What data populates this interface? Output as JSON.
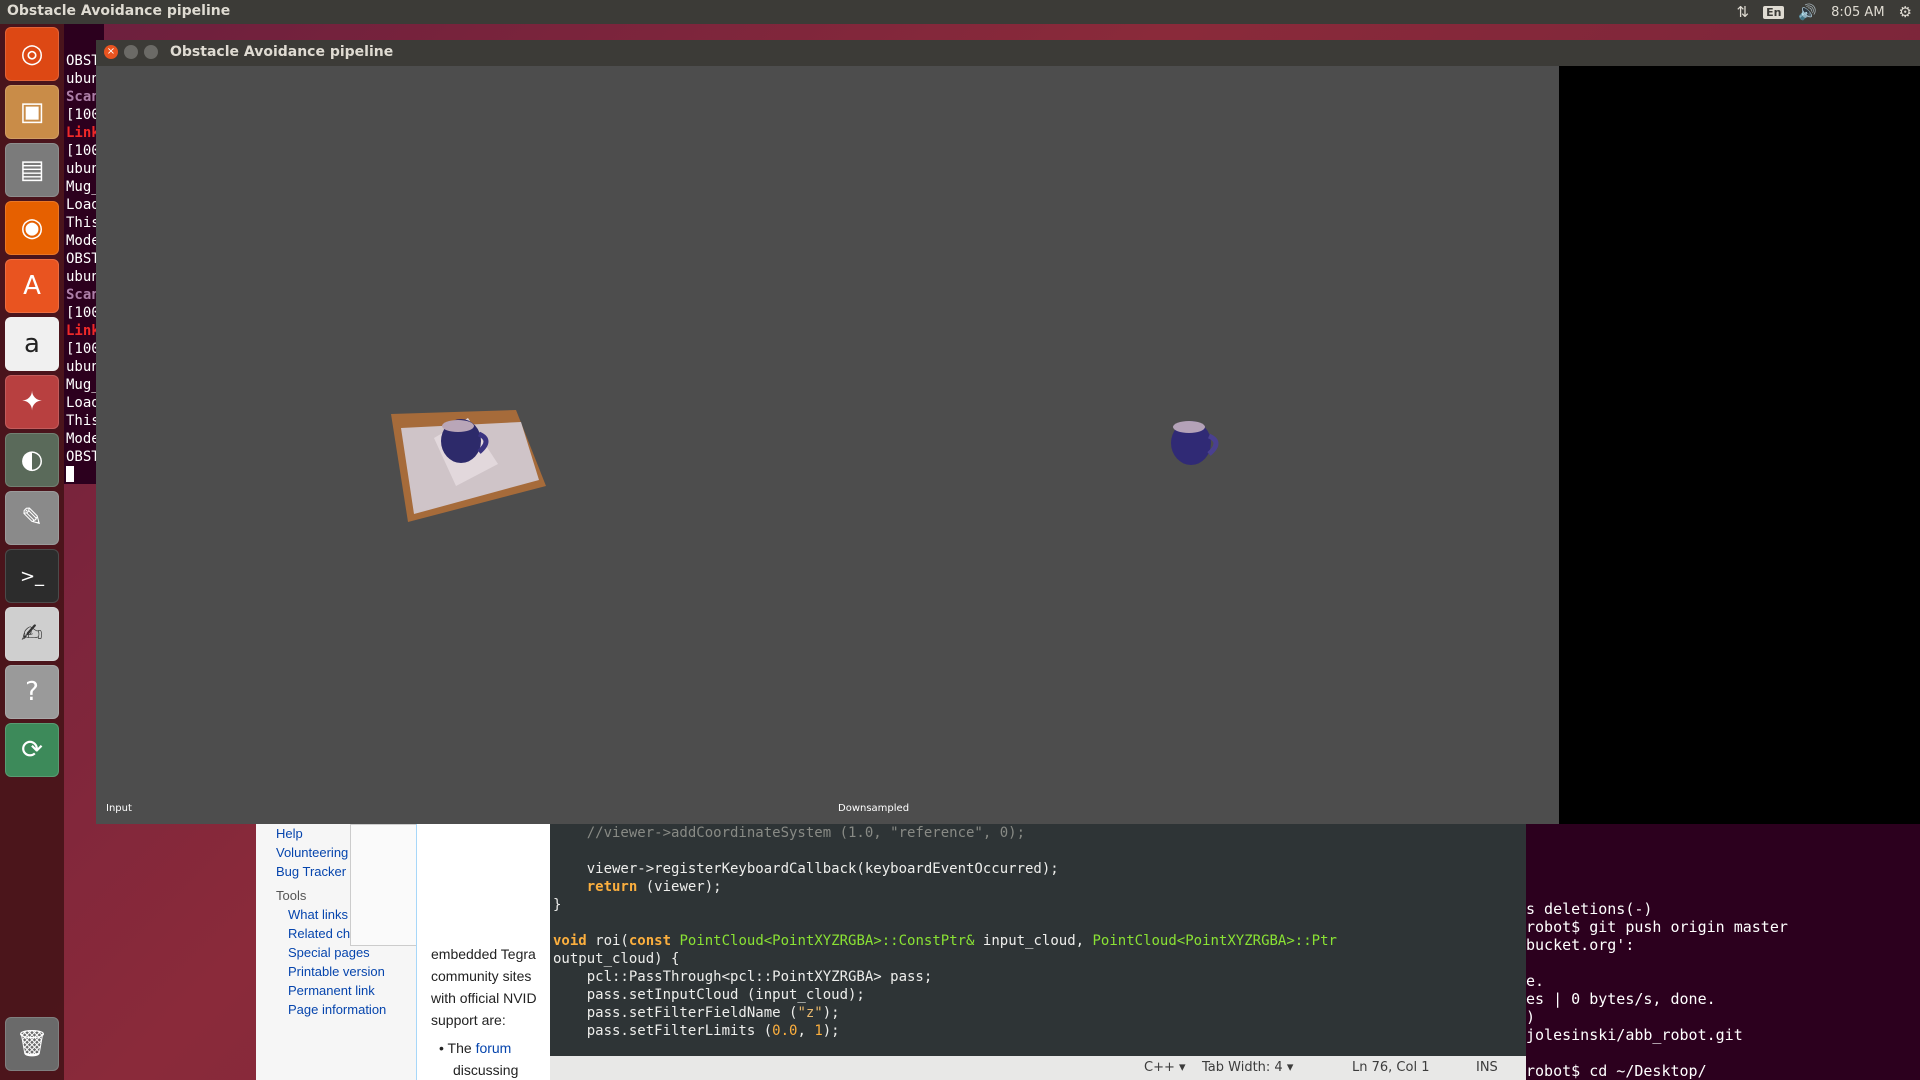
{
  "top_panel": {
    "title": "Obstacle Avoidance pipeline",
    "keyboard": "En",
    "clock": "8:05 AM",
    "icons": [
      "network-icon",
      "keyboard-icon",
      "volume-icon",
      "settings-gear-icon"
    ]
  },
  "launcher": {
    "items": [
      "ubuntu-dash-icon",
      "image-viewer-icon",
      "files-icon",
      "firefox-icon",
      "software-center-icon",
      "amazon-icon",
      "system-settings-icon",
      "disk-usage-icon",
      "system-tools-icon",
      "terminal-icon",
      "text-editor-icon",
      "help-icon",
      "software-updater-icon",
      "trash-icon"
    ]
  },
  "bg_terminal": {
    "lines": [
      {
        "t": "OBST",
        "c": ""
      },
      {
        "t": "ubun",
        "c": ""
      },
      {
        "t": "Scan",
        "c": "purple"
      },
      {
        "t": "[100",
        "c": ""
      },
      {
        "t": "Link",
        "c": "red"
      },
      {
        "t": "[100",
        "c": ""
      },
      {
        "t": "ubun",
        "c": ""
      },
      {
        "t": "Mug_",
        "c": ""
      },
      {
        "t": "Load",
        "c": ""
      },
      {
        "t": "This",
        "c": ""
      },
      {
        "t": "Mode",
        "c": ""
      },
      {
        "t": "OBST",
        "c": ""
      },
      {
        "t": "ubun",
        "c": ""
      },
      {
        "t": "Scan",
        "c": "purple"
      },
      {
        "t": "[100",
        "c": ""
      },
      {
        "t": "Link",
        "c": "red"
      },
      {
        "t": "[100",
        "c": ""
      },
      {
        "t": "ubun",
        "c": ""
      },
      {
        "t": "Mug_",
        "c": ""
      },
      {
        "t": "Load",
        "c": ""
      },
      {
        "t": "This",
        "c": ""
      },
      {
        "t": "Mode",
        "c": ""
      },
      {
        "t": "OBST",
        "c": ""
      }
    ]
  },
  "wiki": {
    "links_top": [
      "Help",
      "Volunteering",
      "Bug Tracker"
    ],
    "tools_heading": "Tools",
    "tools": [
      "What links",
      "Related ch",
      "Special pages",
      "Printable version",
      "Permanent link",
      "Page information"
    ],
    "content_lines": [
      "embedded Tegra",
      "community sites",
      "with official NVID",
      "support are:"
    ],
    "bullet_prefix": "The",
    "bullet_link": "forum",
    "bullet_cont": "discussing"
  },
  "editor": {
    "status": {
      "lang": "C++ ▾",
      "tab": "Tab Width: 4 ▾",
      "pos": "Ln 76, Col 1",
      "mode": "INS"
    }
  },
  "bg_terminal2": {
    "lines": [
      "s deletions(-)",
      "robot$ git push origin master",
      "bucket.org':",
      "",
      "e.",
      "es | 0 bytes/s, done.",
      ")",
      "jolesinski/abb_robot.git",
      "",
      "robot$ cd ~/Desktop/"
    ]
  },
  "viewer": {
    "title": "Obstacle Avoidance pipeline",
    "label_left": "Input",
    "label_right": "Downsampled"
  }
}
